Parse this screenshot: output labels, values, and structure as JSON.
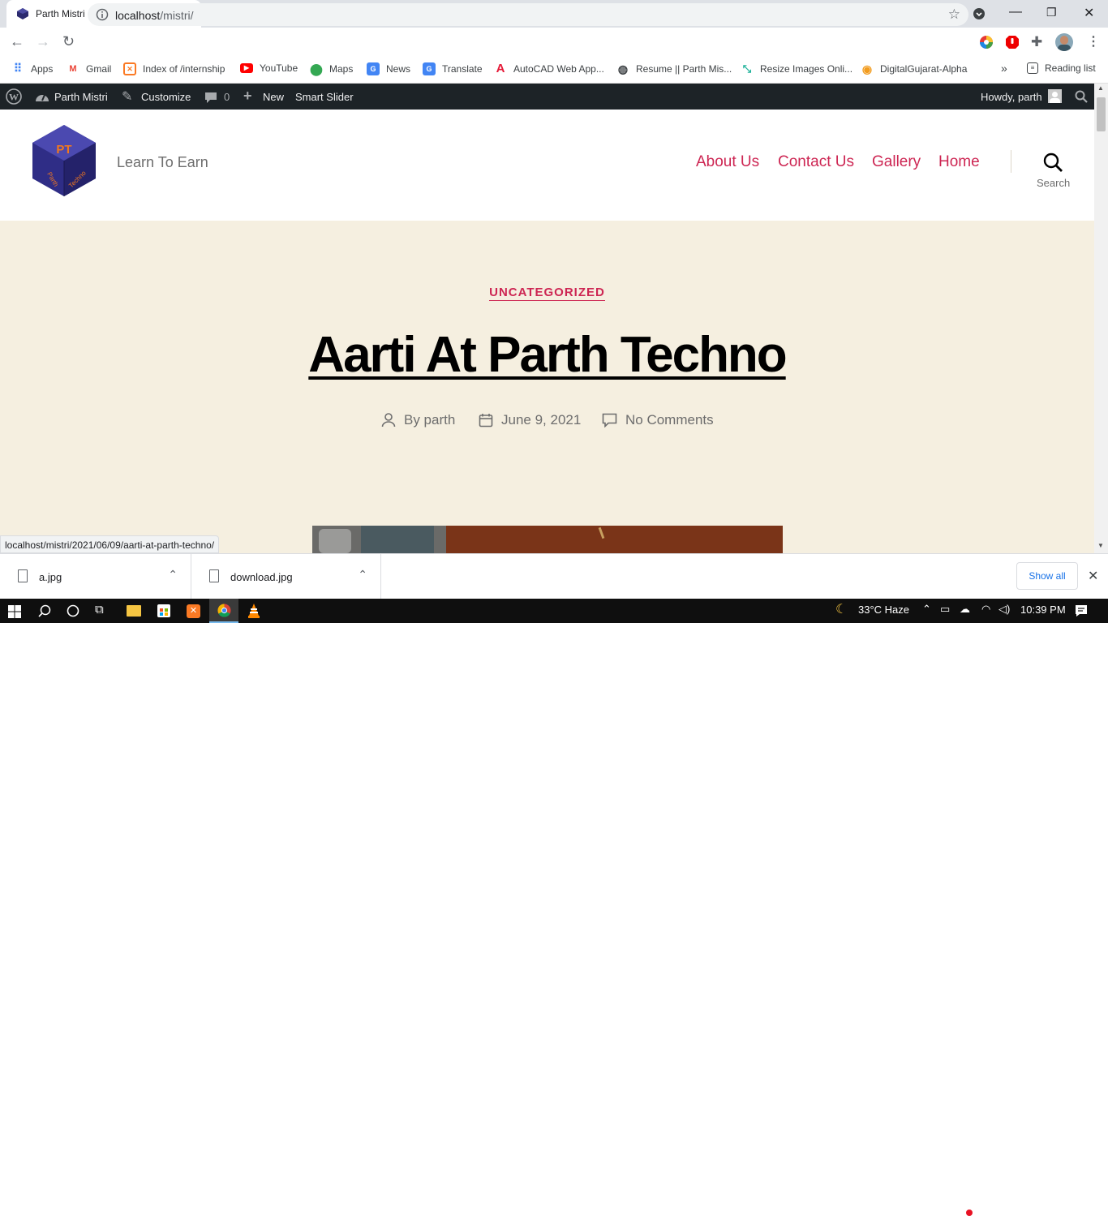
{
  "browser": {
    "tab_title": "Parth Mistri – Learn To Earn",
    "url_host": "localhost",
    "url_path": "/mistri/"
  },
  "bookmarks": [
    {
      "label": "Apps",
      "icon": "apps-grid-icon"
    },
    {
      "label": "Gmail",
      "icon": "gmail-icon"
    },
    {
      "label": "Index of /internship",
      "icon": "xampp-icon"
    },
    {
      "label": "YouTube",
      "icon": "youtube-icon"
    },
    {
      "label": "Maps",
      "icon": "maps-icon"
    },
    {
      "label": "News",
      "icon": "news-icon"
    },
    {
      "label": "Translate",
      "icon": "translate-icon"
    },
    {
      "label": "AutoCAD Web App...",
      "icon": "autocad-icon"
    },
    {
      "label": "Resume || Parth Mis...",
      "icon": "globe-icon"
    },
    {
      "label": "Resize Images Onli...",
      "icon": "resize-icon"
    },
    {
      "label": "DigitalGujarat-Alpha",
      "icon": "digitalgujarat-icon"
    }
  ],
  "reading_list": "Reading list",
  "adminbar": {
    "site_name": "Parth Mistri",
    "customize": "Customize",
    "comments_count": "0",
    "new": "New",
    "smart_slider": "Smart Slider",
    "howdy": "Howdy, parth"
  },
  "site": {
    "tagline": "Learn To Earn",
    "logo_text_top": "PT",
    "logo_text_side1": "Parth",
    "logo_text_side2": "Techno",
    "nav": [
      "About Us",
      "Contact Us",
      "Gallery",
      "Home"
    ],
    "search_label": "Search"
  },
  "post": {
    "category": "UNCATEGORIZED",
    "title": "Aarti At Parth Techno",
    "author": "By parth",
    "date": "June 9, 2021",
    "comments": "No Comments"
  },
  "status_url": "localhost/mistri/2021/06/09/aarti-at-parth-techno/",
  "downloads": {
    "items": [
      "a.jpg",
      "download.jpg"
    ],
    "show_all": "Show all"
  },
  "taskbar": {
    "weather": "33°C  Haze",
    "time": "10:39 PM"
  },
  "colors": {
    "accent": "#cd2653",
    "hero_bg": "#f5efe0",
    "adminbar_bg": "#1d2327"
  }
}
